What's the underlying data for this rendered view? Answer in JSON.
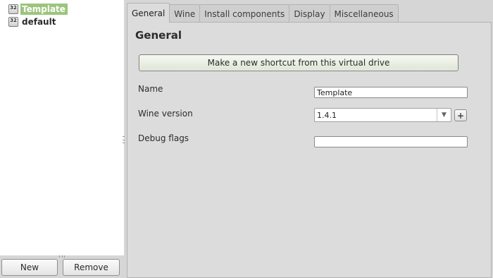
{
  "sidebar": {
    "drive_icon_text": "32",
    "items": [
      {
        "label": "Template",
        "selected": true
      },
      {
        "label": "default",
        "selected": false
      }
    ],
    "new_button": "New",
    "remove_button": "Remove"
  },
  "tabs": [
    {
      "label": "General",
      "active": true
    },
    {
      "label": "Wine",
      "active": false
    },
    {
      "label": "Install components",
      "active": false
    },
    {
      "label": "Display",
      "active": false
    },
    {
      "label": "Miscellaneous",
      "active": false
    }
  ],
  "general": {
    "title": "General",
    "shortcut_button": "Make a new shortcut from this virtual drive",
    "name_label": "Name",
    "name_value": "Template",
    "wine_version_label": "Wine version",
    "wine_version_value": "1.4.1",
    "add_version_symbol": "+",
    "debug_flags_label": "Debug flags",
    "debug_flags_value": ""
  },
  "icons": {
    "drive": "virtual-drive-icon",
    "dropdown": "chevron-down-icon",
    "add": "plus-icon"
  },
  "colors": {
    "selection": "#9cc57c",
    "window_bg": "#d6d6d6"
  }
}
